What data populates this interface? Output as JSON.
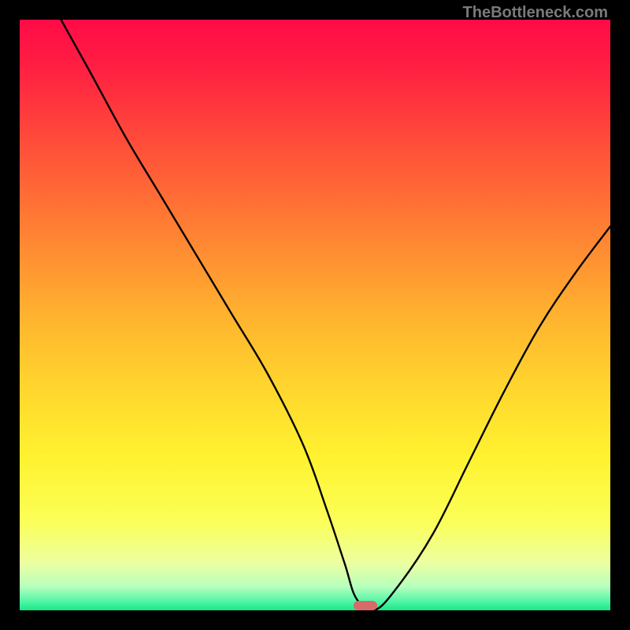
{
  "watermark": {
    "text": "TheBottleneck.com"
  },
  "chart_data": {
    "type": "line",
    "title": "",
    "xlabel": "",
    "ylabel": "",
    "xlim": [
      0,
      100
    ],
    "ylim": [
      0,
      100
    ],
    "grid": false,
    "legend": false,
    "series": [
      {
        "name": "bottleneck-curve",
        "color": "#000000",
        "x": [
          7,
          12,
          18,
          24,
          30,
          36,
          42,
          48,
          52,
          55,
          57,
          60,
          64,
          70,
          76,
          82,
          88,
          94,
          100
        ],
        "y": [
          100,
          91,
          80,
          70,
          60,
          50,
          40,
          28,
          17,
          8,
          2,
          0,
          4,
          13,
          25,
          37,
          48,
          57,
          65
        ]
      }
    ],
    "marker": {
      "x": 58.5,
      "y": 0.8,
      "color": "#d86a6a"
    },
    "background_gradient_stops": [
      {
        "pos": 0.0,
        "color": "#ff0b46"
      },
      {
        "pos": 0.08,
        "color": "#ff1f42"
      },
      {
        "pos": 0.2,
        "color": "#ff4a3a"
      },
      {
        "pos": 0.35,
        "color": "#ff7e33"
      },
      {
        "pos": 0.5,
        "color": "#ffb22f"
      },
      {
        "pos": 0.62,
        "color": "#ffd52e"
      },
      {
        "pos": 0.74,
        "color": "#fff22f"
      },
      {
        "pos": 0.85,
        "color": "#fbff58"
      },
      {
        "pos": 0.92,
        "color": "#ecffa1"
      },
      {
        "pos": 0.96,
        "color": "#b7ffbd"
      },
      {
        "pos": 0.985,
        "color": "#52f5a7"
      },
      {
        "pos": 1.0,
        "color": "#17e884"
      }
    ]
  }
}
